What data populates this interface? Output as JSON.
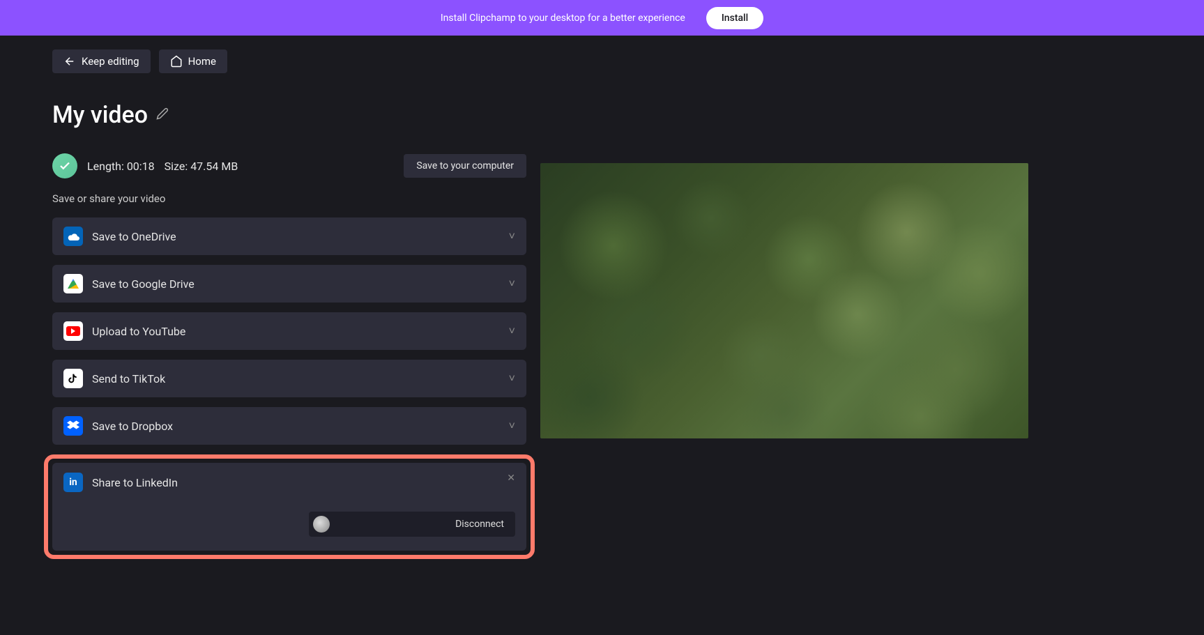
{
  "banner": {
    "text": "Install Clipchamp to your desktop for a better experience",
    "install_label": "Install"
  },
  "nav": {
    "keep_editing": "Keep editing",
    "home": "Home"
  },
  "title": "My video",
  "video_info": {
    "length_label": "Length:",
    "length_value": "00:18",
    "size_label": "Size:",
    "size_value": "47.54 MB"
  },
  "save_computer": "Save to your computer",
  "subtitle": "Save or share your video",
  "options": [
    {
      "id": "onedrive",
      "label": "Save to OneDrive"
    },
    {
      "id": "gdrive",
      "label": "Save to Google Drive"
    },
    {
      "id": "youtube",
      "label": "Upload to YouTube"
    },
    {
      "id": "tiktok",
      "label": "Send to TikTok"
    },
    {
      "id": "dropbox",
      "label": "Save to Dropbox"
    },
    {
      "id": "linkedin",
      "label": "Share to LinkedIn"
    }
  ],
  "linkedin": {
    "disconnect": "Disconnect"
  }
}
